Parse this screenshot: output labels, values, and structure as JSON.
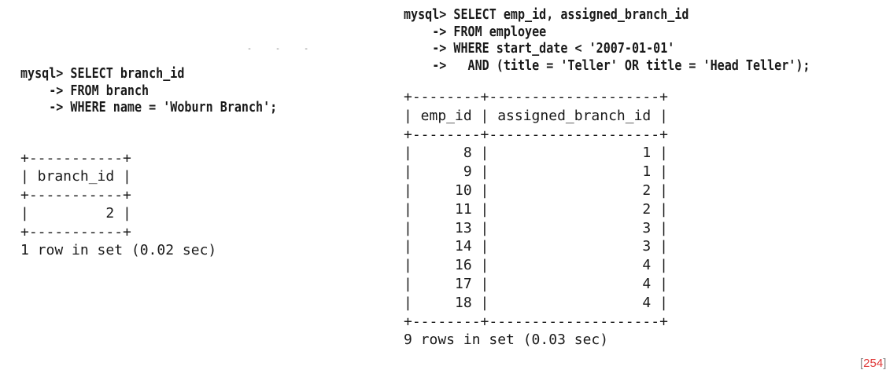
{
  "left_query": {
    "command_lines": [
      "mysql> SELECT branch_id",
      "    -> FROM branch",
      "    -> WHERE name = 'Woburn Branch';"
    ],
    "result": {
      "columns": [
        "branch_id"
      ],
      "rows": [
        [
          "2"
        ]
      ],
      "table_lines": [
        "+-----------+",
        "| branch_id |",
        "+-----------+",
        "|         2 |",
        "+-----------+"
      ],
      "status": "1 row in set (0.02 sec)"
    }
  },
  "right_query": {
    "command_lines": [
      "mysql> SELECT emp_id, assigned_branch_id",
      "    -> FROM employee",
      "    -> WHERE start_date < '2007-01-01'",
      "    ->   AND (title = 'Teller' OR title = 'Head Teller');"
    ],
    "result": {
      "columns": [
        "emp_id",
        "assigned_branch_id"
      ],
      "rows": [
        [
          "8",
          "1"
        ],
        [
          "9",
          "1"
        ],
        [
          "10",
          "2"
        ],
        [
          "11",
          "2"
        ],
        [
          "13",
          "3"
        ],
        [
          "14",
          "3"
        ],
        [
          "16",
          "4"
        ],
        [
          "17",
          "4"
        ],
        [
          "18",
          "4"
        ]
      ],
      "table_lines": [
        "+--------+--------------------+",
        "| emp_id | assigned_branch_id |",
        "+--------+--------------------+",
        "|      8 |                  1 |",
        "|      9 |                  1 |",
        "|     10 |                  2 |",
        "|     11 |                  2 |",
        "|     13 |                  3 |",
        "|     14 |                  3 |",
        "|     16 |                  4 |",
        "|     17 |                  4 |",
        "|     18 |                  4 |",
        "+--------+--------------------+"
      ],
      "status": "9 rows in set (0.03 sec)"
    }
  },
  "page_marker": {
    "open": "[",
    "number": "254",
    "close": "]"
  }
}
